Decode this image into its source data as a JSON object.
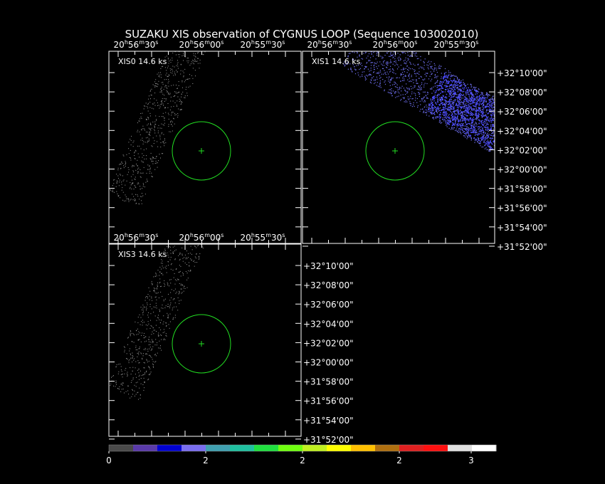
{
  "title": "SUZAKU XIS observation of CYGNUS LOOP  (Sequence 103002010)",
  "ra_tick_labels": [
    {
      "h": "20",
      "m": "56",
      "s": "30"
    },
    {
      "h": "20",
      "m": "56",
      "s": "00"
    },
    {
      "h": "20",
      "m": "55",
      "s": "30"
    }
  ],
  "dec_tick_labels": [
    "+32°10'00\"",
    "+32°08'00\"",
    "+32°06'00\"",
    "+32°04'00\"",
    "+32°02'00\"",
    "+32°00'00\"",
    "+31°58'00\"",
    "+31°56'00\"",
    "+31°54'00\"",
    "+31°52'00\""
  ],
  "panels": [
    {
      "id": "xis0",
      "label": "XIS0 14.6 ks",
      "show_ra_top": true,
      "show_dec_right": false
    },
    {
      "id": "xis1",
      "label": "XIS1 14.6 ks",
      "show_ra_top": true,
      "show_dec_right": true
    },
    {
      "id": "xis3",
      "label": "XIS3 14.6 ks",
      "show_ra_top": true,
      "show_dec_right": true
    }
  ],
  "colorbar": {
    "colors": [
      "#4a4a4a",
      "#5a3aaa",
      "#0000d0",
      "#7a6ef0",
      "#40a0b0",
      "#20c0a0",
      "#20e040",
      "#70ff10",
      "#c0f020",
      "#ffff00",
      "#ffc000",
      "#b07010",
      "#e02020",
      "#ff1010",
      "#e0e0e0",
      "#ffffff"
    ],
    "labels": [
      "0",
      "2",
      "2",
      "2",
      "3"
    ]
  },
  "colors": {
    "region_circle": "#22dd22",
    "events_xis0": "#9a9a9a",
    "events_xis1": "#6f6ff0",
    "background": "#000000",
    "frame": "#ffffff"
  }
}
